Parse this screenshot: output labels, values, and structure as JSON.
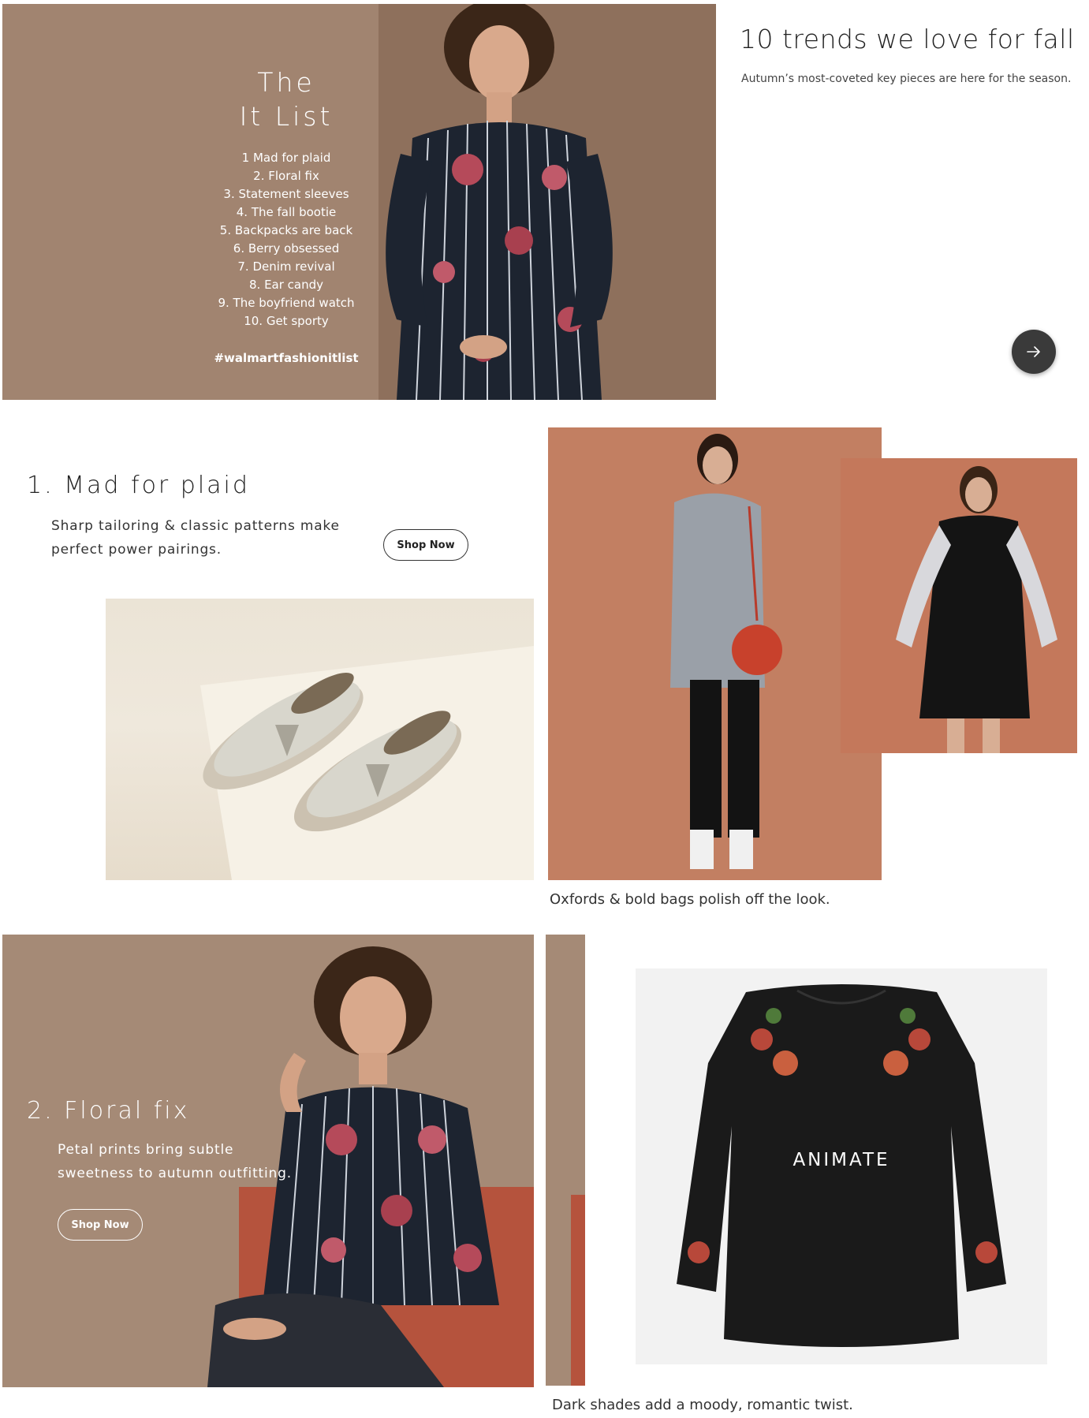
{
  "hero": {
    "title_line1": "The",
    "title_line2": "It List",
    "list": [
      "1  Mad for plaid",
      "2.  Floral fix",
      "3.  Statement sleeves",
      "4.  The fall bootie",
      "5.  Backpacks are back",
      "6.  Berry obsessed",
      "7.  Denim revival",
      "8.  Ear candy",
      "9.  The boyfriend watch",
      "10.  Get sporty"
    ],
    "hashtag": "#walmartfashionitlist"
  },
  "intro": {
    "title": "10 trends we love for fall",
    "subtitle": "Autumn’s most-coveted key pieces are here for the season.",
    "next_icon": "arrow-right-icon"
  },
  "section1": {
    "title": "1. Mad for plaid",
    "text_line1": "Sharp tailoring & classic patterns make",
    "text_line2": "perfect power pairings.",
    "button": "Shop Now",
    "caption": "Oxfords & bold bags polish off the look."
  },
  "section2": {
    "title": "2. Floral fix",
    "text_line1": "Petal prints bring subtle",
    "text_line2": "sweetness to autumn outfitting.",
    "button": "Shop Now",
    "product_label": "ANIMATE",
    "caption": "Dark shades add a moody, romantic twist."
  },
  "colors": {
    "hero_bg": "#a18470",
    "terracotta": "#c07e62",
    "button_dark": "#3a3a3a"
  }
}
